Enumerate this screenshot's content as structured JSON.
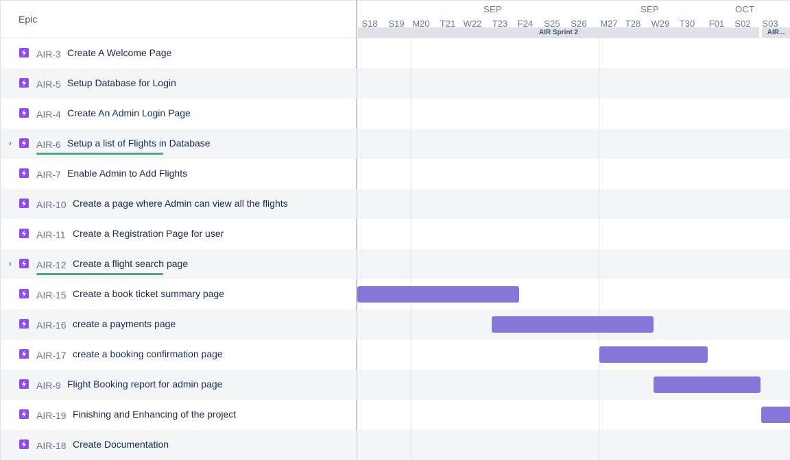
{
  "header": {
    "column_title": "Epic"
  },
  "timeline": {
    "months": [
      "SEP",
      "SEP",
      "OCT"
    ],
    "days": [
      "S18",
      "S19",
      "M20",
      "T21",
      "W22",
      "T23",
      "F24",
      "S25",
      "S26",
      "M27",
      "T28",
      "W29",
      "T30",
      "F01",
      "S02",
      "S03"
    ],
    "sprints": [
      "AIR Sprint 2",
      "AIR..."
    ]
  },
  "rows": [
    {
      "key": "AIR-3",
      "summary": "Create A Welcome Page",
      "expandable": false,
      "progress": false
    },
    {
      "key": "AIR-5",
      "summary": "Setup Database for Login",
      "expandable": false,
      "progress": false
    },
    {
      "key": "AIR-4",
      "summary": "Create An Admin Login Page",
      "expandable": false,
      "progress": false
    },
    {
      "key": "AIR-6",
      "summary": "Setup a list of Flights in Database",
      "expandable": true,
      "progress": true
    },
    {
      "key": "AIR-7",
      "summary": "Enable Admin to Add Flights",
      "expandable": false,
      "progress": false
    },
    {
      "key": "AIR-10",
      "summary": "Create a page where Admin can view all the flights",
      "expandable": false,
      "progress": false
    },
    {
      "key": "AIR-11",
      "summary": "Create a Registration Page for user",
      "expandable": false,
      "progress": false
    },
    {
      "key": "AIR-12",
      "summary": "Create a flight search page",
      "expandable": true,
      "progress": true
    },
    {
      "key": "AIR-15",
      "summary": "Create a book ticket summary page",
      "expandable": false,
      "progress": false
    },
    {
      "key": "AIR-16",
      "summary": "create a payments page",
      "expandable": false,
      "progress": false
    },
    {
      "key": "AIR-17",
      "summary": "create a booking confirmation page",
      "expandable": false,
      "progress": false
    },
    {
      "key": "AIR-9",
      "summary": "Flight Booking report for admin page",
      "expandable": false,
      "progress": false
    },
    {
      "key": "AIR-19",
      "summary": "Finishing and Enhancing of the project",
      "expandable": false,
      "progress": false
    },
    {
      "key": "AIR-18",
      "summary": "Create Documentation",
      "expandable": false,
      "progress": false
    }
  ],
  "colors": {
    "bar": "#8777d9",
    "epic_icon": "#904ee2",
    "progress": "#36b37e"
  },
  "icons": {
    "epic": "lightning-bolt-icon",
    "expand": "chevron-right-icon"
  }
}
